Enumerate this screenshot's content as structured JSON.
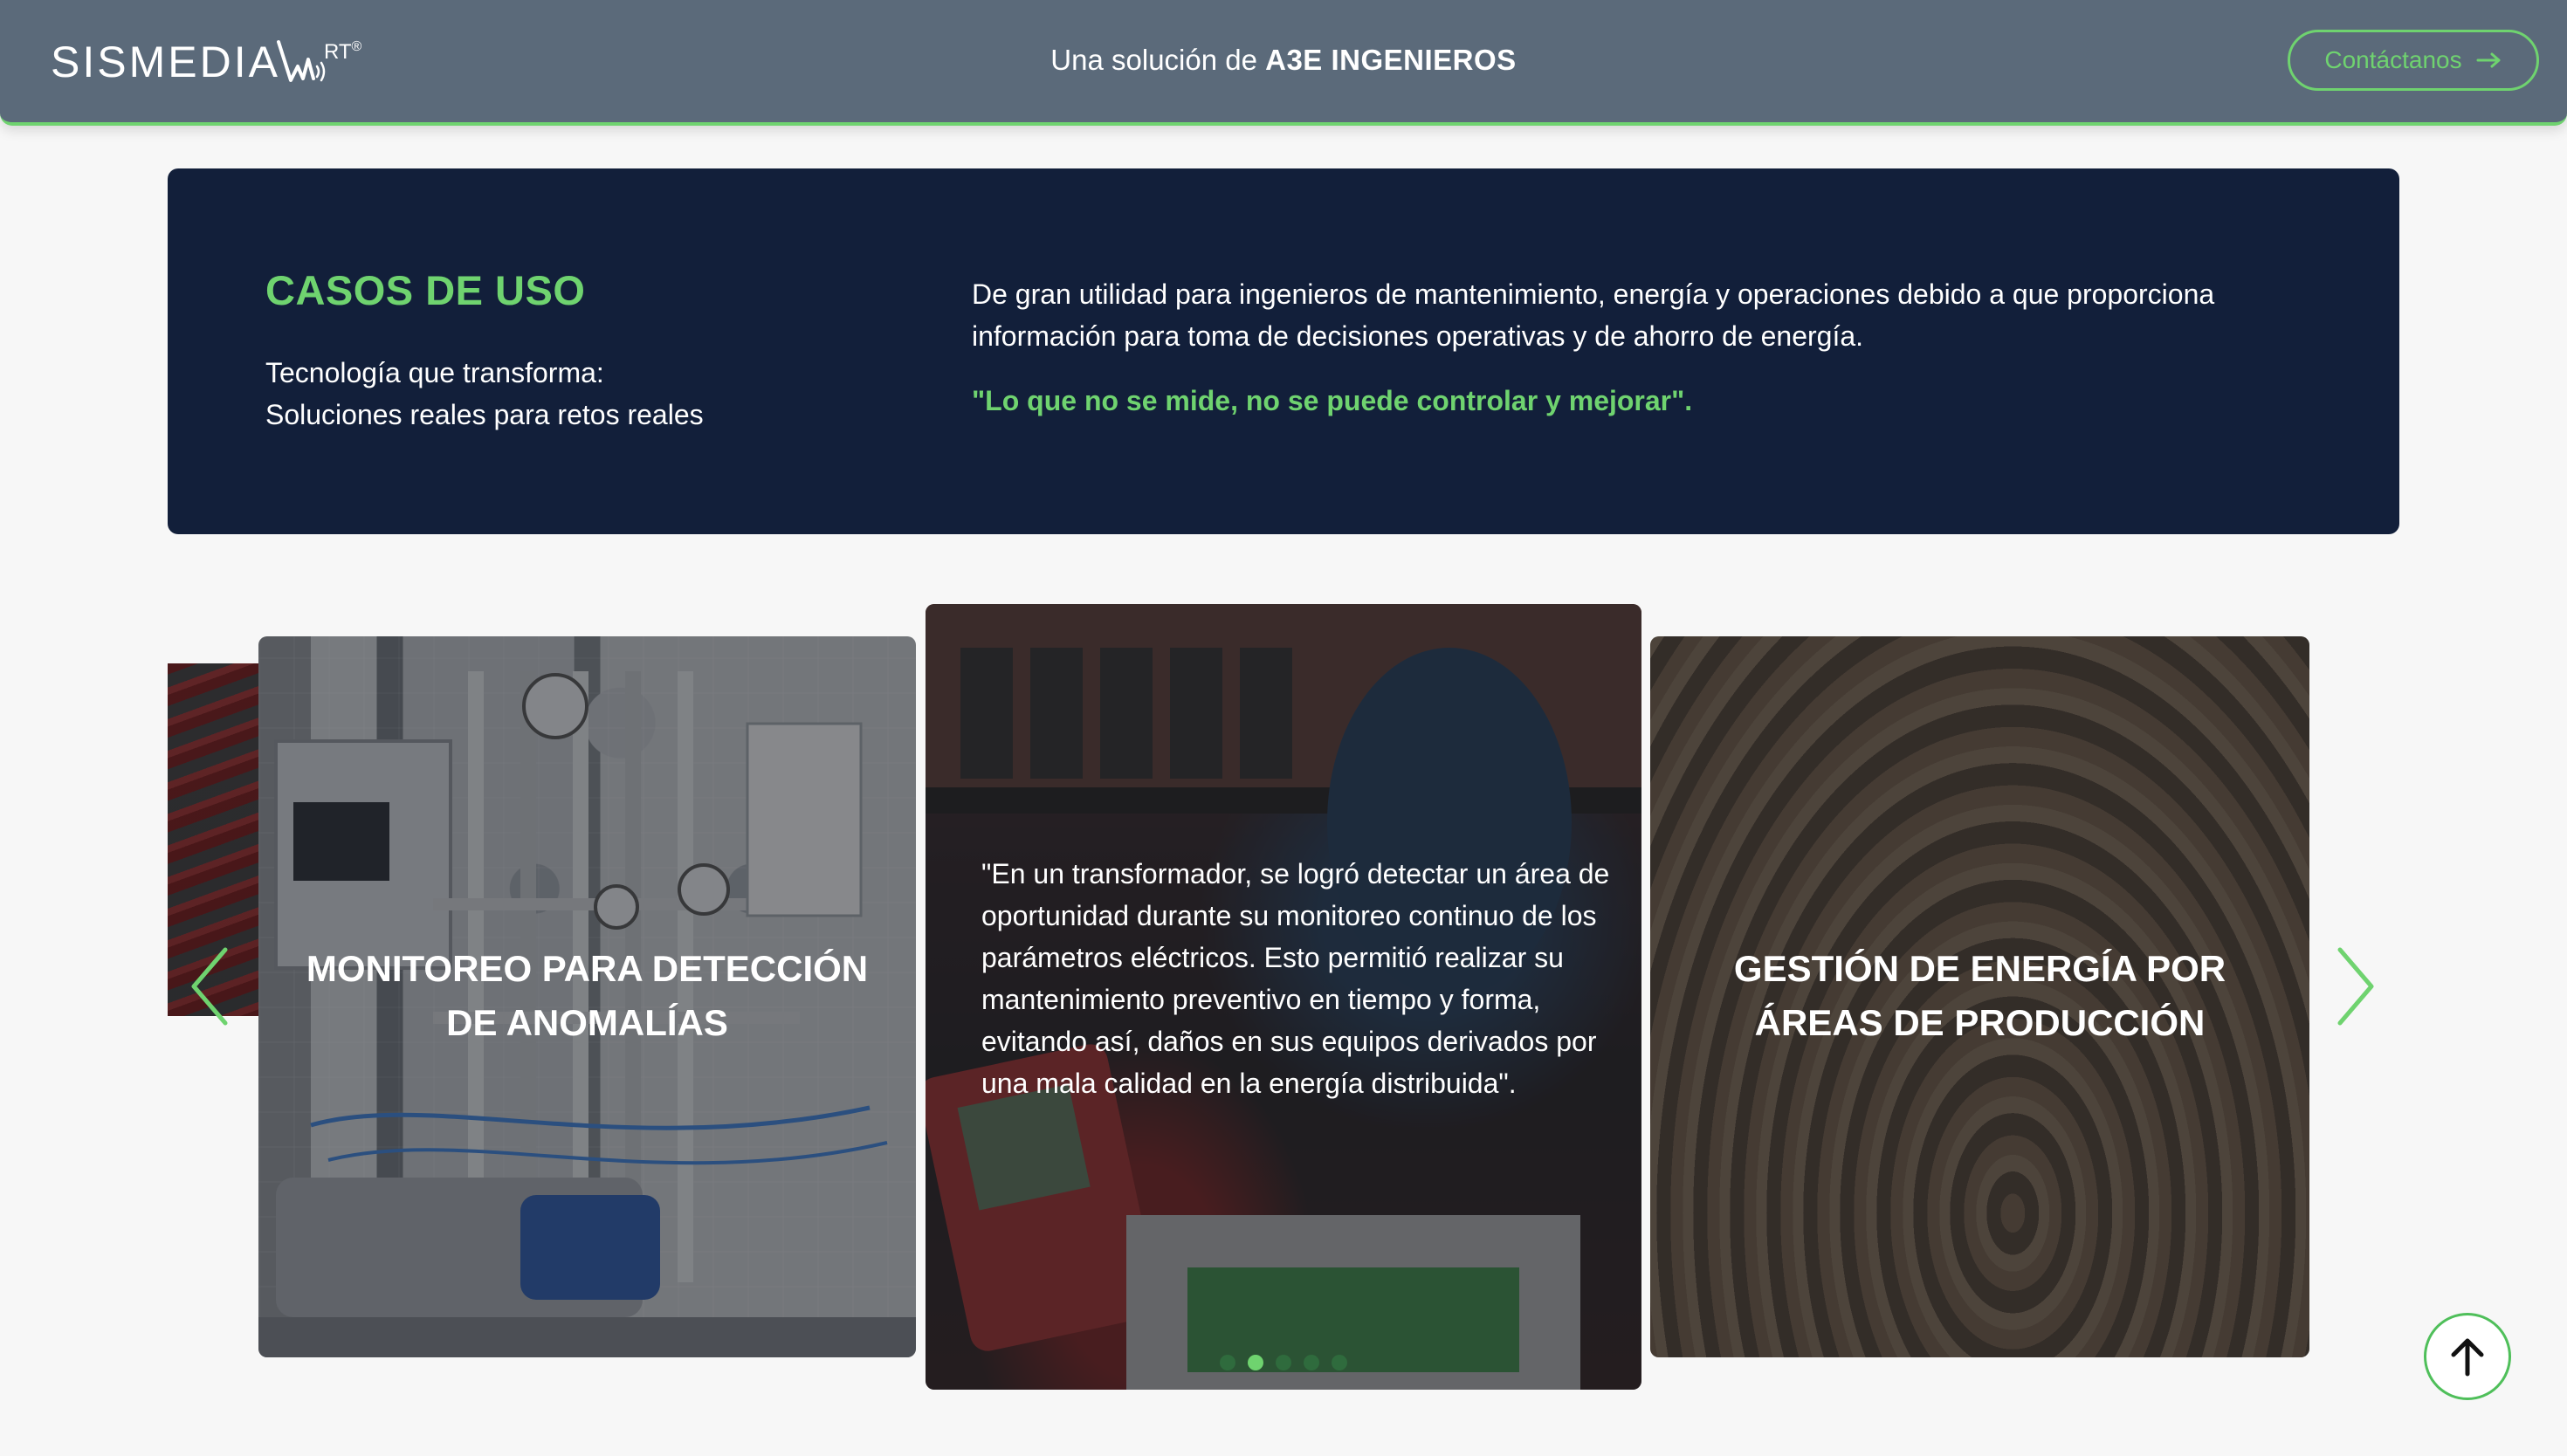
{
  "header": {
    "logo_text": "SISMEDIA",
    "logo_suffix": "RT",
    "logo_registered": "®",
    "tagline_prefix": "Una solución de",
    "tagline_brand": "A3E INGENIEROS",
    "contact_label": "Contáctanos",
    "contact_icon": "arrow-right-icon"
  },
  "use_cases": {
    "title": "CASOS DE USO",
    "subtitle_line1": "Tecnología que transforma:",
    "subtitle_line2": "Soluciones reales para retos reales",
    "description": "De gran utilidad para ingenieros de mantenimiento, energía y operaciones debido a que proporciona información para toma de decisiones operativas y de ahorro de energía.",
    "quote": "\"Lo que no se mide, no se puede controlar y mejorar\"."
  },
  "carousel": {
    "slides": [
      {
        "title": "MONITOREO PARA DETECCIÓN DE ANOMALÍAS"
      },
      {
        "text": "\"En un transformador, se logró detectar un área de oportunidad durante su monitoreo continuo de los parámetros eléctricos. Esto permitió realizar su mantenimiento preventivo en tiempo y forma, evitando así, daños en sus equipos derivados por una mala calidad en la energía distribuida\"."
      },
      {
        "title": "GESTIÓN DE ENERGÍA POR ÁREAS DE PRODUCCIÓN"
      }
    ],
    "dots_count": 5,
    "active_dot": 2,
    "prev_icon": "chevron-left-icon",
    "next_icon": "chevron-right-icon"
  },
  "to_top_icon": "arrow-up-icon",
  "colors": {
    "accent": "#6fd36f",
    "header_bg": "#5b6a7a",
    "banner_bg": "#121f3a",
    "page_bg": "#f7f7f7"
  }
}
